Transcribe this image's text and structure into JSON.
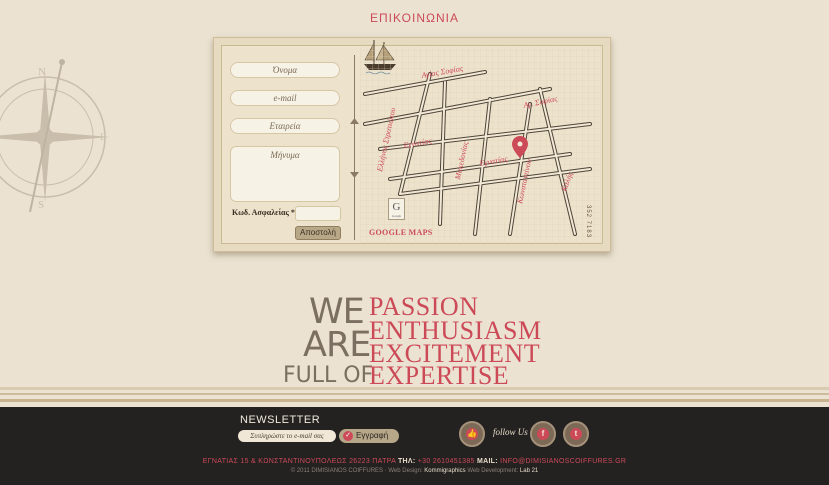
{
  "header": {
    "title": "ΕΠΙΚΟΙΝΩΝΙΑ"
  },
  "form": {
    "name_placeholder": "Όνομα",
    "email_placeholder": "e-mail",
    "company_placeholder": "Εταιρεία",
    "message_placeholder": "Μήνυμα",
    "captcha_label": "Κωδ. Ασφαλείας *",
    "submit_label": "Αποστολή"
  },
  "map": {
    "streets": [
      "Αγίας Σοφίας",
      "Αγ. Σοφίας",
      "Ελλήνος Στρατιώτου",
      "Εγνατίας",
      "Μακεδονίας",
      "Εγνατίας",
      "Κωνσταντίνου",
      "Καλής"
    ],
    "link_label": "GOOGLE MAPS",
    "badge_letter": "G",
    "badge_sub": "Google",
    "code": "352 7183"
  },
  "slogan": {
    "we": "WE",
    "are": "ARE",
    "full_of": "FULL OF",
    "words": [
      "PASSION",
      "ENTHUSIASM",
      "EXCITEMENT",
      "EXPERTISE"
    ]
  },
  "footer": {
    "newsletter_title": "NEWSLETTER",
    "newsletter_placeholder": "Συπληρώστε το e-mail σας",
    "subscribe_label": "Εγγραφή",
    "follow_label": "follow Us",
    "address": "ΕΓΝΑΤΙΑΣ 15 & ΚΩΝΣΤΑΝΤΙΝΟΥΠΟΛΕΩΣ 26223 ΠΑΤΡΑ",
    "tel_label": "ΤΗΛ:",
    "tel": "+30 2610451385",
    "mail_label": "MAIL:",
    "mail": "INFO@DIMISIANOSCOIFFURES.GR",
    "credits_prefix": "© 2011 DIMISIANOS COIFFURES · Web Design:",
    "design_by": "Kommigraphics",
    "dev_prefix": "Web Development:",
    "dev_by": "Lab 21"
  },
  "colors": {
    "accent": "#cc4a58",
    "footer_bg": "#242121",
    "page_bg": "#ebe2d1"
  }
}
